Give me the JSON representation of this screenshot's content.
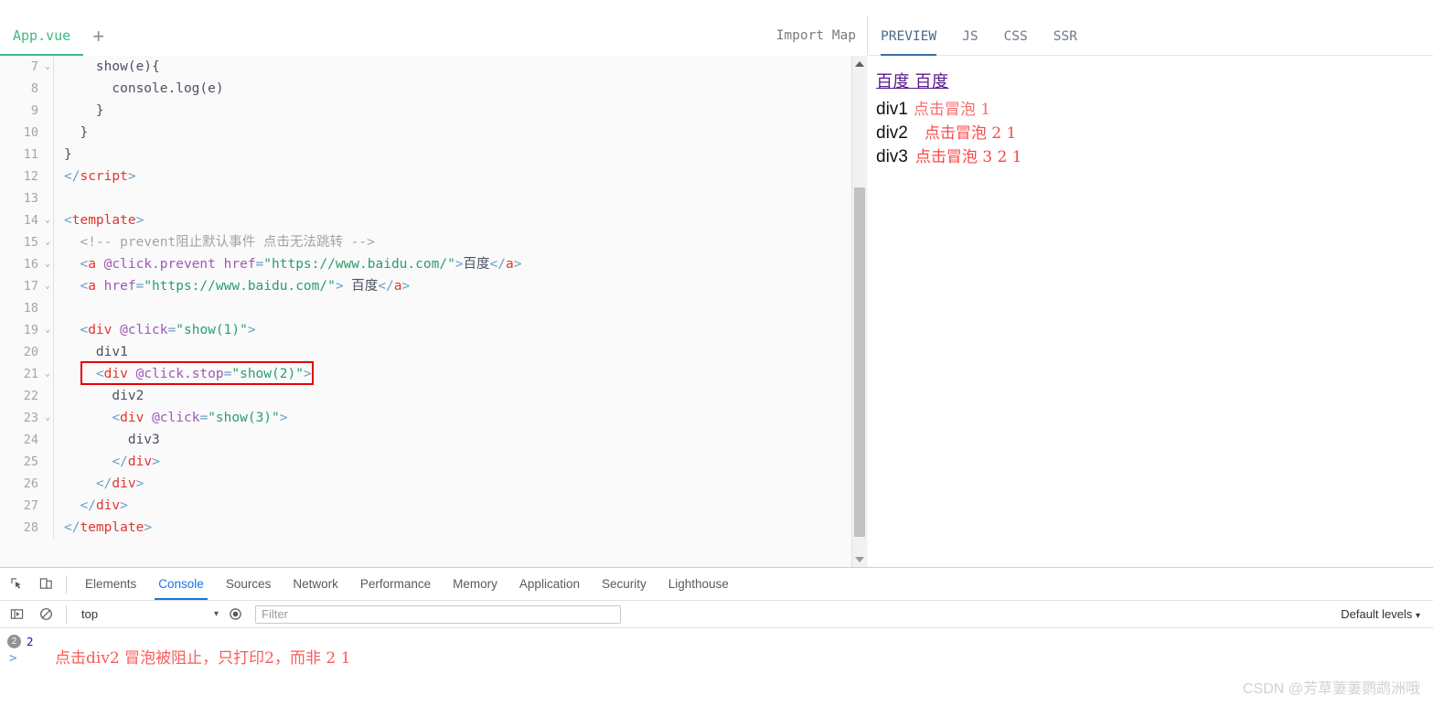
{
  "editor": {
    "tabs": [
      {
        "label": "App.vue",
        "active": true
      }
    ],
    "add_tab_label": "+",
    "import_map_label": "Import Map",
    "lines": [
      {
        "num": "7",
        "fold": "⌄",
        "tokens": [
          {
            "t": "plain",
            "v": "    show(e){"
          }
        ]
      },
      {
        "num": "8",
        "fold": "",
        "tokens": [
          {
            "t": "plain",
            "v": "      console.log(e)"
          }
        ]
      },
      {
        "num": "9",
        "fold": "",
        "tokens": [
          {
            "t": "plain",
            "v": "    }"
          }
        ]
      },
      {
        "num": "10",
        "fold": "",
        "tokens": [
          {
            "t": "plain",
            "v": "  }"
          }
        ]
      },
      {
        "num": "11",
        "fold": "",
        "tokens": [
          {
            "t": "plain",
            "v": "}"
          }
        ]
      },
      {
        "num": "12",
        "fold": "",
        "tokens": [
          {
            "t": "punct",
            "v": "</"
          },
          {
            "t": "tag",
            "v": "script"
          },
          {
            "t": "punct",
            "v": ">"
          }
        ]
      },
      {
        "num": "13",
        "fold": "",
        "tokens": [
          {
            "t": "plain",
            "v": ""
          }
        ]
      },
      {
        "num": "14",
        "fold": "⌄",
        "tokens": [
          {
            "t": "punct",
            "v": "<"
          },
          {
            "t": "tag",
            "v": "template"
          },
          {
            "t": "punct",
            "v": ">"
          }
        ]
      },
      {
        "num": "15",
        "fold": "⌄",
        "tokens": [
          {
            "t": "comment",
            "v": "  <!-- prevent阻止默认事件 点击无法跳转 -->"
          }
        ]
      },
      {
        "num": "16",
        "fold": "⌄",
        "tokens": [
          {
            "t": "plain",
            "v": "  "
          },
          {
            "t": "punct",
            "v": "<"
          },
          {
            "t": "tag",
            "v": "a"
          },
          {
            "t": "plain",
            "v": " "
          },
          {
            "t": "attr",
            "v": "@click.prevent"
          },
          {
            "t": "plain",
            "v": " "
          },
          {
            "t": "attr",
            "v": "href"
          },
          {
            "t": "punct",
            "v": "="
          },
          {
            "t": "string",
            "v": "\"https://www.baidu.com/\""
          },
          {
            "t": "punct",
            "v": ">"
          },
          {
            "t": "plain",
            "v": "百度"
          },
          {
            "t": "punct",
            "v": "</"
          },
          {
            "t": "tag",
            "v": "a"
          },
          {
            "t": "punct",
            "v": ">"
          }
        ]
      },
      {
        "num": "17",
        "fold": "⌄",
        "tokens": [
          {
            "t": "plain",
            "v": "  "
          },
          {
            "t": "punct",
            "v": "<"
          },
          {
            "t": "tag",
            "v": "a"
          },
          {
            "t": "plain",
            "v": " "
          },
          {
            "t": "attr",
            "v": "href"
          },
          {
            "t": "punct",
            "v": "="
          },
          {
            "t": "string",
            "v": "\"https://www.baidu.com/\""
          },
          {
            "t": "punct",
            "v": ">"
          },
          {
            "t": "plain",
            "v": " 百度"
          },
          {
            "t": "punct",
            "v": "</"
          },
          {
            "t": "tag",
            "v": "a"
          },
          {
            "t": "punct",
            "v": ">"
          }
        ]
      },
      {
        "num": "18",
        "fold": "",
        "tokens": [
          {
            "t": "plain",
            "v": ""
          }
        ]
      },
      {
        "num": "19",
        "fold": "⌄",
        "tokens": [
          {
            "t": "plain",
            "v": "  "
          },
          {
            "t": "punct",
            "v": "<"
          },
          {
            "t": "tag",
            "v": "div"
          },
          {
            "t": "plain",
            "v": " "
          },
          {
            "t": "attr",
            "v": "@click"
          },
          {
            "t": "punct",
            "v": "="
          },
          {
            "t": "string",
            "v": "\"show(1)\""
          },
          {
            "t": "punct",
            "v": ">"
          }
        ]
      },
      {
        "num": "20",
        "fold": "",
        "tokens": [
          {
            "t": "plain",
            "v": "    div1"
          }
        ]
      },
      {
        "num": "21",
        "fold": "⌄",
        "tokens": [
          {
            "t": "plain",
            "v": "    "
          },
          {
            "t": "punct",
            "v": "<"
          },
          {
            "t": "tag",
            "v": "div"
          },
          {
            "t": "plain",
            "v": " "
          },
          {
            "t": "attr",
            "v": "@click.stop"
          },
          {
            "t": "punct",
            "v": "="
          },
          {
            "t": "string",
            "v": "\"show(2)\""
          },
          {
            "t": "punct",
            "v": ">"
          }
        ]
      },
      {
        "num": "22",
        "fold": "",
        "tokens": [
          {
            "t": "plain",
            "v": "      div2"
          }
        ]
      },
      {
        "num": "23",
        "fold": "⌄",
        "tokens": [
          {
            "t": "plain",
            "v": "      "
          },
          {
            "t": "punct",
            "v": "<"
          },
          {
            "t": "tag",
            "v": "div"
          },
          {
            "t": "plain",
            "v": " "
          },
          {
            "t": "attr",
            "v": "@click"
          },
          {
            "t": "punct",
            "v": "="
          },
          {
            "t": "string",
            "v": "\"show(3)\""
          },
          {
            "t": "punct",
            "v": ">"
          }
        ]
      },
      {
        "num": "24",
        "fold": "",
        "tokens": [
          {
            "t": "plain",
            "v": "        div3"
          }
        ]
      },
      {
        "num": "25",
        "fold": "",
        "tokens": [
          {
            "t": "plain",
            "v": "      "
          },
          {
            "t": "punct",
            "v": "</"
          },
          {
            "t": "tag",
            "v": "div"
          },
          {
            "t": "punct",
            "v": ">"
          }
        ]
      },
      {
        "num": "26",
        "fold": "",
        "tokens": [
          {
            "t": "plain",
            "v": "    "
          },
          {
            "t": "punct",
            "v": "</"
          },
          {
            "t": "tag",
            "v": "div"
          },
          {
            "t": "punct",
            "v": ">"
          }
        ]
      },
      {
        "num": "27",
        "fold": "",
        "tokens": [
          {
            "t": "plain",
            "v": "  "
          },
          {
            "t": "punct",
            "v": "</"
          },
          {
            "t": "tag",
            "v": "div"
          },
          {
            "t": "punct",
            "v": ">"
          }
        ]
      },
      {
        "num": "28",
        "fold": "",
        "tokens": [
          {
            "t": "punct",
            "v": "</"
          },
          {
            "t": "tag",
            "v": "template"
          },
          {
            "t": "punct",
            "v": ">"
          }
        ]
      }
    ],
    "highlight_color": "#e60000"
  },
  "preview": {
    "tabs": [
      {
        "label": "PREVIEW",
        "active": true
      },
      {
        "label": "JS",
        "active": false
      },
      {
        "label": "CSS",
        "active": false
      },
      {
        "label": "SSR",
        "active": false
      }
    ],
    "links_text": "百度 百度",
    "rows": [
      {
        "label": "div1",
        "note": "点击冒泡 1",
        "indent": 0
      },
      {
        "label": "div2",
        "note": "点击冒泡 2 1",
        "indent": 12
      },
      {
        "label": "div3",
        "note": "点击冒泡 3 2 1",
        "indent": 2
      }
    ]
  },
  "devtools": {
    "tabs": [
      {
        "label": "Elements",
        "active": false
      },
      {
        "label": "Console",
        "active": true
      },
      {
        "label": "Sources",
        "active": false
      },
      {
        "label": "Network",
        "active": false
      },
      {
        "label": "Performance",
        "active": false
      },
      {
        "label": "Memory",
        "active": false
      },
      {
        "label": "Application",
        "active": false
      },
      {
        "label": "Security",
        "active": false
      },
      {
        "label": "Lighthouse",
        "active": false
      }
    ],
    "context_value": "top",
    "filter_placeholder": "Filter",
    "filter_value": "",
    "levels_label": "Default levels",
    "console": {
      "badge_count": "2",
      "logged_value": "2",
      "prompt": ">",
      "annotation": "点击div2 冒泡被阻止，只打印2，而非 2 1"
    }
  },
  "watermark": "CSDN @芳草萋萋鹦鹉洲哦"
}
